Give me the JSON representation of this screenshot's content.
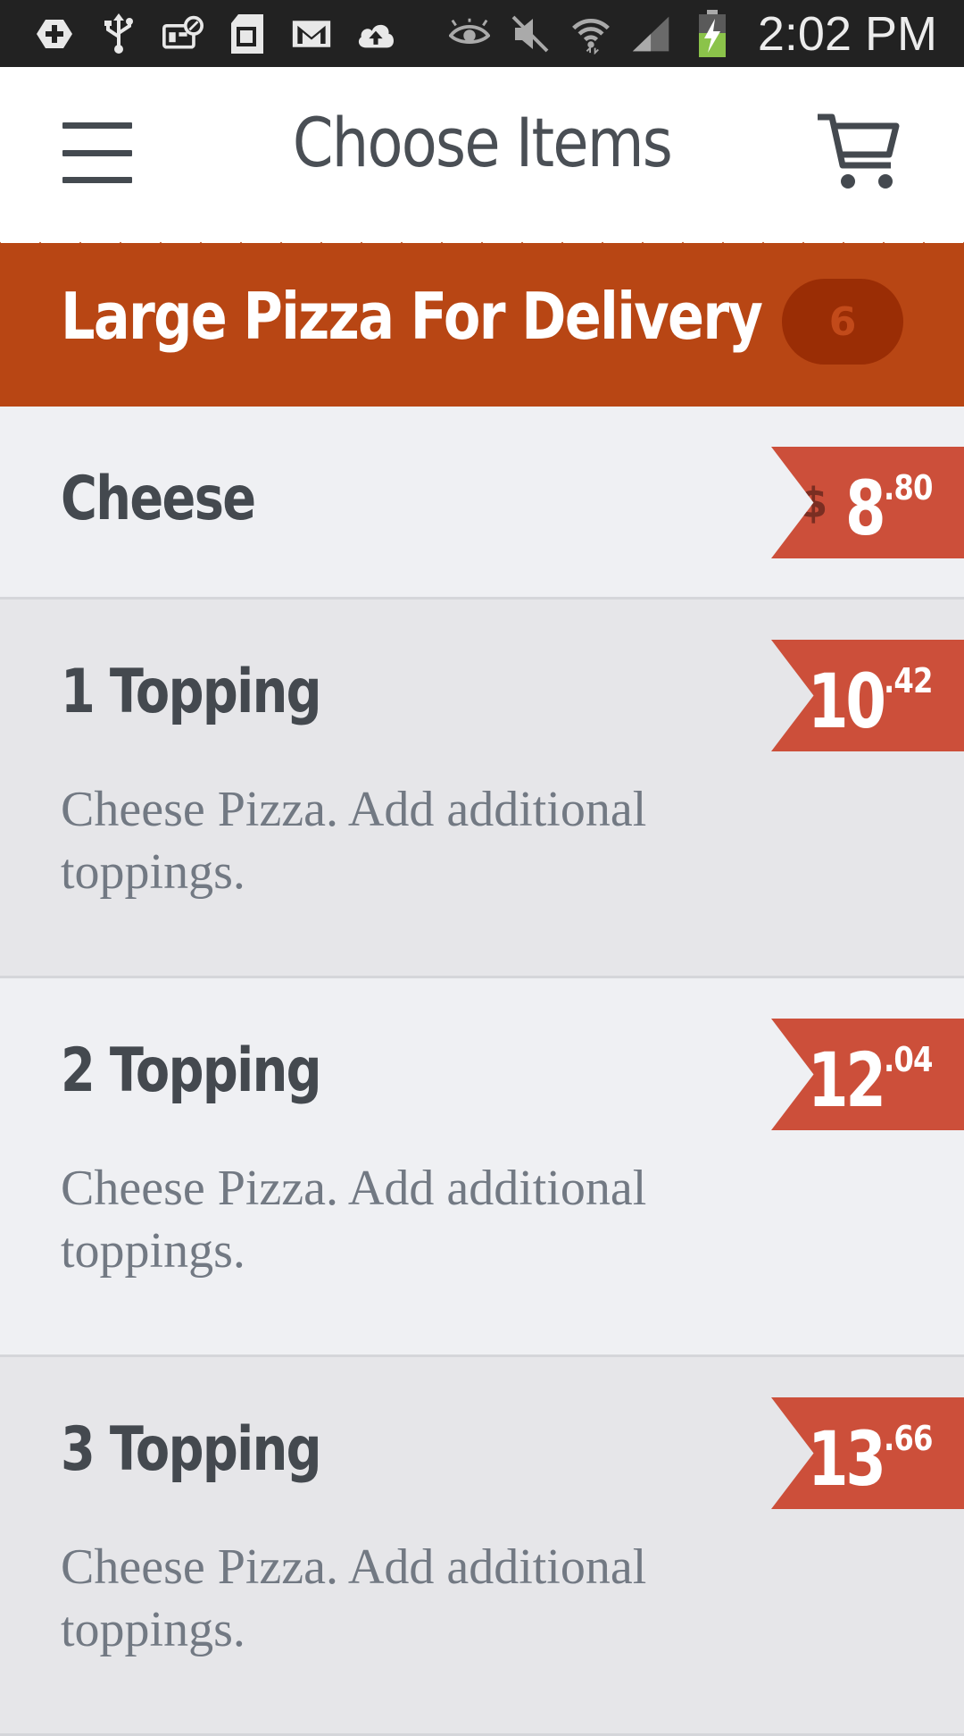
{
  "status_bar": {
    "time": "2:02 PM",
    "icons": [
      "add-box-icon",
      "usb-icon",
      "voicemail-icon",
      "sd-card-icon",
      "gmail-icon",
      "cloud-upload-icon",
      "eye-icon",
      "mute-icon",
      "wifi-icon",
      "signal-icon",
      "battery-charging-icon"
    ]
  },
  "header": {
    "title": "Choose Items",
    "menu_icon": "hamburger-menu-icon",
    "cart_icon": "cart-icon"
  },
  "category": {
    "title": "Large Pizza For Delivery",
    "count": "6"
  },
  "colors": {
    "banner": "#b84614",
    "price_tag": "#cc4f3a",
    "badge": "#9a2d05"
  },
  "items": [
    {
      "name": "Cheese",
      "currency": "$",
      "dollars": "8",
      "cents": ".80",
      "description": ""
    },
    {
      "name": "1 Topping",
      "currency": "$",
      "dollars": "10",
      "cents": ".42",
      "description": "Cheese Pizza.  Add additional toppings."
    },
    {
      "name": "2 Topping",
      "currency": "$",
      "dollars": "12",
      "cents": ".04",
      "description": "Cheese Pizza.  Add additional toppings."
    },
    {
      "name": "3 Topping",
      "currency": "$",
      "dollars": "13",
      "cents": ".66",
      "description": "Cheese Pizza.  Add additional toppings."
    }
  ]
}
